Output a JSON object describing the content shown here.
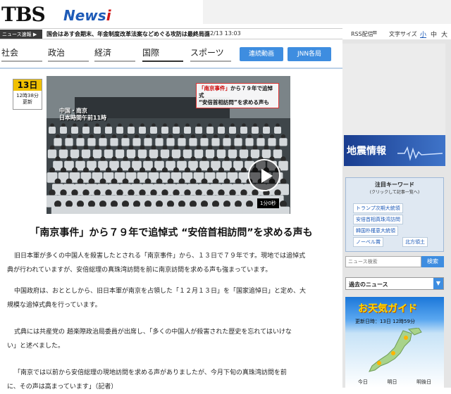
{
  "header": {
    "logo_main": "TBS",
    "logo_news": "News",
    "logo_i": "i"
  },
  "breaking": {
    "label": "ニュース速報 ▶",
    "text": "国会はあす会期末、年金制度改革法案などめぐる攻防は最終局面",
    "time": "12/13 13:03"
  },
  "tools": {
    "rss": "RSS配信",
    "font_size_label": "文字サイズ",
    "font_small": "小",
    "font_mid": "中",
    "font_large": "大"
  },
  "nav": {
    "items": [
      "社会",
      "政治",
      "経済",
      "国際",
      "スポーツ"
    ],
    "active": "国際",
    "buttons": [
      "連続動画",
      "JNN各局"
    ]
  },
  "article": {
    "date_day": "13日",
    "date_time": "12時38分",
    "date_updated": "更新",
    "video_caption_red": "「南京事件」",
    "video_caption_1": "から７９年で追悼式",
    "video_caption_2": "“安倍首相訪問”を求める声も",
    "video_location_1": "中国・南京",
    "video_location_2": "日本時間午前11時",
    "video_duration": "1分0秒",
    "headline": "「南京事件」から７９年で追悼式 “安倍首相訪問”を求める声も",
    "paragraphs": [
      "旧日本軍が多くの中国人を殺害したとされる「南京事件」から、１３日で７９年です。現地では追悼式",
      "典が行われていますが、安倍総理の真珠湾訪問を前に南京訪問を求める声も強まっています。",
      "中国政府は、おととしから、旧日本軍が南京を占領した「１２月１３日」を「国家追悼日」と定め、大",
      "規模な追悼式典を行っています。",
      "式典には共産党の 趙楽際政治局委員が出席し、「多くの中国人が殺害された歴史を忘れてはいけな",
      "い」と述べました。",
      "「南京では以前から安倍総理の現地訪問を求める声がありましたが、今月下旬の真珠湾訪問を前",
      "に、その声は高まっています」（記者）"
    ]
  },
  "sidebar": {
    "earthquake": "地震情報",
    "keywords_title": "注目キーワード",
    "keywords_sub": "(クリックして記事一覧へ)",
    "keywords": [
      "トランプ次期大統領",
      "安倍首相真珠湾訪問",
      "韓国朴槿恵大統領",
      "ノーベル賞",
      "北方領土"
    ],
    "search_placeholder": "ニュース検索",
    "search_button": "検索",
    "past_news": "過去のニュース",
    "past_news_arrow": "▼",
    "weather_title": "お天気ガイド",
    "weather_updated": "更新日時：13日 12時59分",
    "weather_days": [
      "今日",
      "明日",
      "明後日"
    ]
  },
  "colors": {
    "accent_blue": "#3e8de0",
    "logo_blue": "#1e5bb8",
    "logo_red": "#d01818",
    "date_yellow": "#f0c000"
  }
}
